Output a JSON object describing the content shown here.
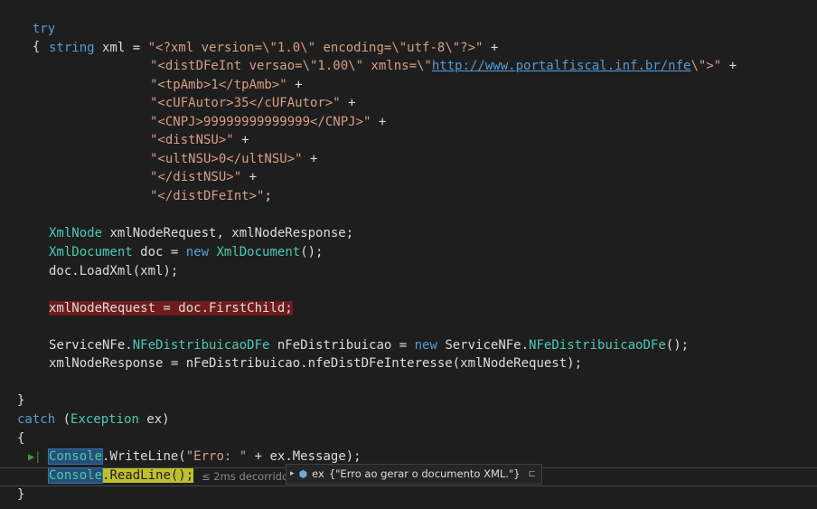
{
  "code": {
    "try_kw": "try",
    "lbrace": "{",
    "rbrace": "}",
    "string_kw": "string",
    "xml_decl": " xml = ",
    "s1": "\"<?xml version=\\\"1.0\\\" encoding=\\\"utf-8\\\"?>\"",
    "plus": " +",
    "s2a": "\"<distDFeInt versao=\\\"1.00\\\" xmlns=\\\"",
    "s2_link": "http://www.portalfiscal.inf.br/nfe",
    "s2b": "\\\">\"",
    "s3": "\"<tpAmb>1</tpAmb>\"",
    "s4": "\"<cUFAutor>35</cUFAutor>\"",
    "s5": "\"<CNPJ>99999999999999</CNPJ>\"",
    "s6": "\"<distNSU>\"",
    "s7": "\"<ultNSU>0</ultNSU>\"",
    "s8": "\"</distNSU>\"",
    "s9": "\"</distDFeInt>\"",
    "semi": ";",
    "xmlnode_type": "XmlNode",
    "xmlnode_rest": " xmlNodeRequest, xmlNodeResponse;",
    "xmldoc_type": "XmlDocument",
    "doc_assign": " doc = ",
    "new_kw": "new",
    "xmldoc_ctor_end": "();",
    "loadxml": "doc.LoadXml(xml);",
    "bp_line": "xmlNodeRequest = doc.FirstChild;",
    "svc_ns": "ServiceNFe.",
    "svc_type": "NFeDistribuicaoDFe",
    "svc_var": " nFeDistribuicao = ",
    "svc_ctor_end": "();",
    "resp_line": "xmlNodeResponse = nFeDistribuicao.nfeDistDFeInteresse(xmlNodeRequest);",
    "catch_kw": "catch",
    "catch_open": " (",
    "exception_type": "Exception",
    "catch_close": " ex)",
    "console": "Console",
    "writeline_a": ".WriteLine(",
    "writeline_str": "\"Erro: \"",
    "writeline_b": " + ex.Message);",
    "readline": ".ReadLine();"
  },
  "perf_tip": "≤ 2ms decorrido",
  "datatip": {
    "expand_icon": "▸",
    "object_icon": "cube-icon",
    "var_name": "ex",
    "value": "{\"Erro ao gerar o documento XML.\"}",
    "pin_icon": "pin-icon"
  },
  "colors": {
    "background": "#1e1e1e",
    "keyword": "#569cd6",
    "type": "#4ec9b0",
    "string": "#d69d85",
    "breakpoint_line": "#6f1c1c"
  }
}
